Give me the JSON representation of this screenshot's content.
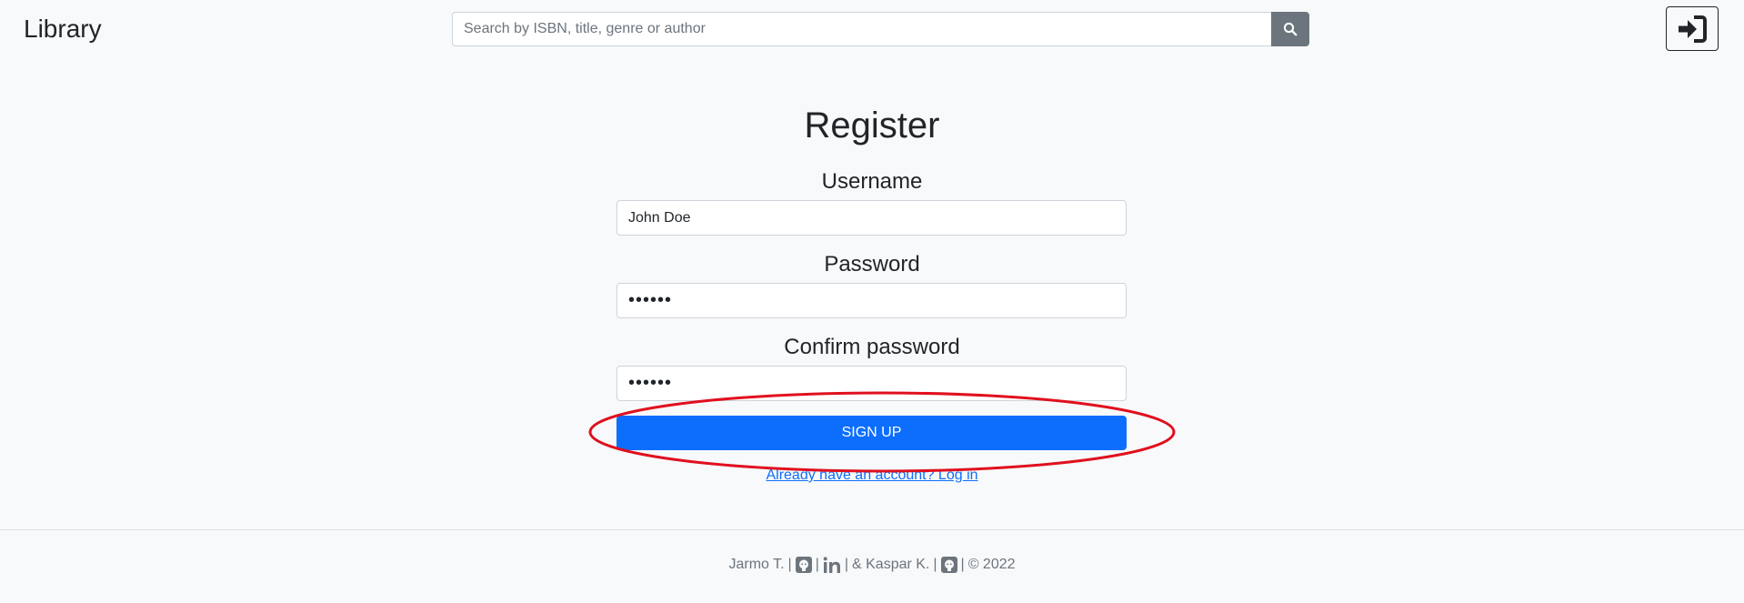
{
  "header": {
    "brand": "Library",
    "search": {
      "placeholder": "Search by ISBN, title, genre or author",
      "value": ""
    },
    "search_icon": "search-icon",
    "login_icon": "sign-in-icon"
  },
  "form": {
    "title": "Register",
    "username": {
      "label": "Username",
      "value": "John Doe"
    },
    "password": {
      "label": "Password",
      "value": "••••••"
    },
    "confirm_password": {
      "label": "Confirm password",
      "value": "••••••"
    },
    "submit_label": "SIGN UP",
    "login_link": "Already have an account? Log in"
  },
  "footer": {
    "author1": "Jarmo T.",
    "author2": "& Kaspar K.",
    "copyright": "© 2022",
    "separator": "|",
    "icons": [
      "github-icon",
      "linkedin-icon",
      "github-icon"
    ]
  },
  "colors": {
    "primary": "#0d6efd",
    "secondary": "#6c757d",
    "background": "#f8f9fa",
    "annotation": "#e0101e"
  }
}
